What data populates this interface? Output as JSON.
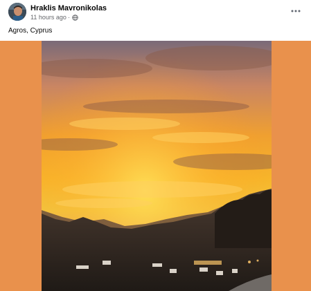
{
  "post": {
    "author": "Hraklis Mavronikolas",
    "timestamp": "11 hours ago",
    "separator": "·",
    "audience_icon": "globe-icon",
    "more_icon": "more-options-icon",
    "caption": "Agros, Cyprus"
  },
  "media": {
    "background_color": "#e9914c",
    "photo_subject": "sunset over mountains"
  }
}
